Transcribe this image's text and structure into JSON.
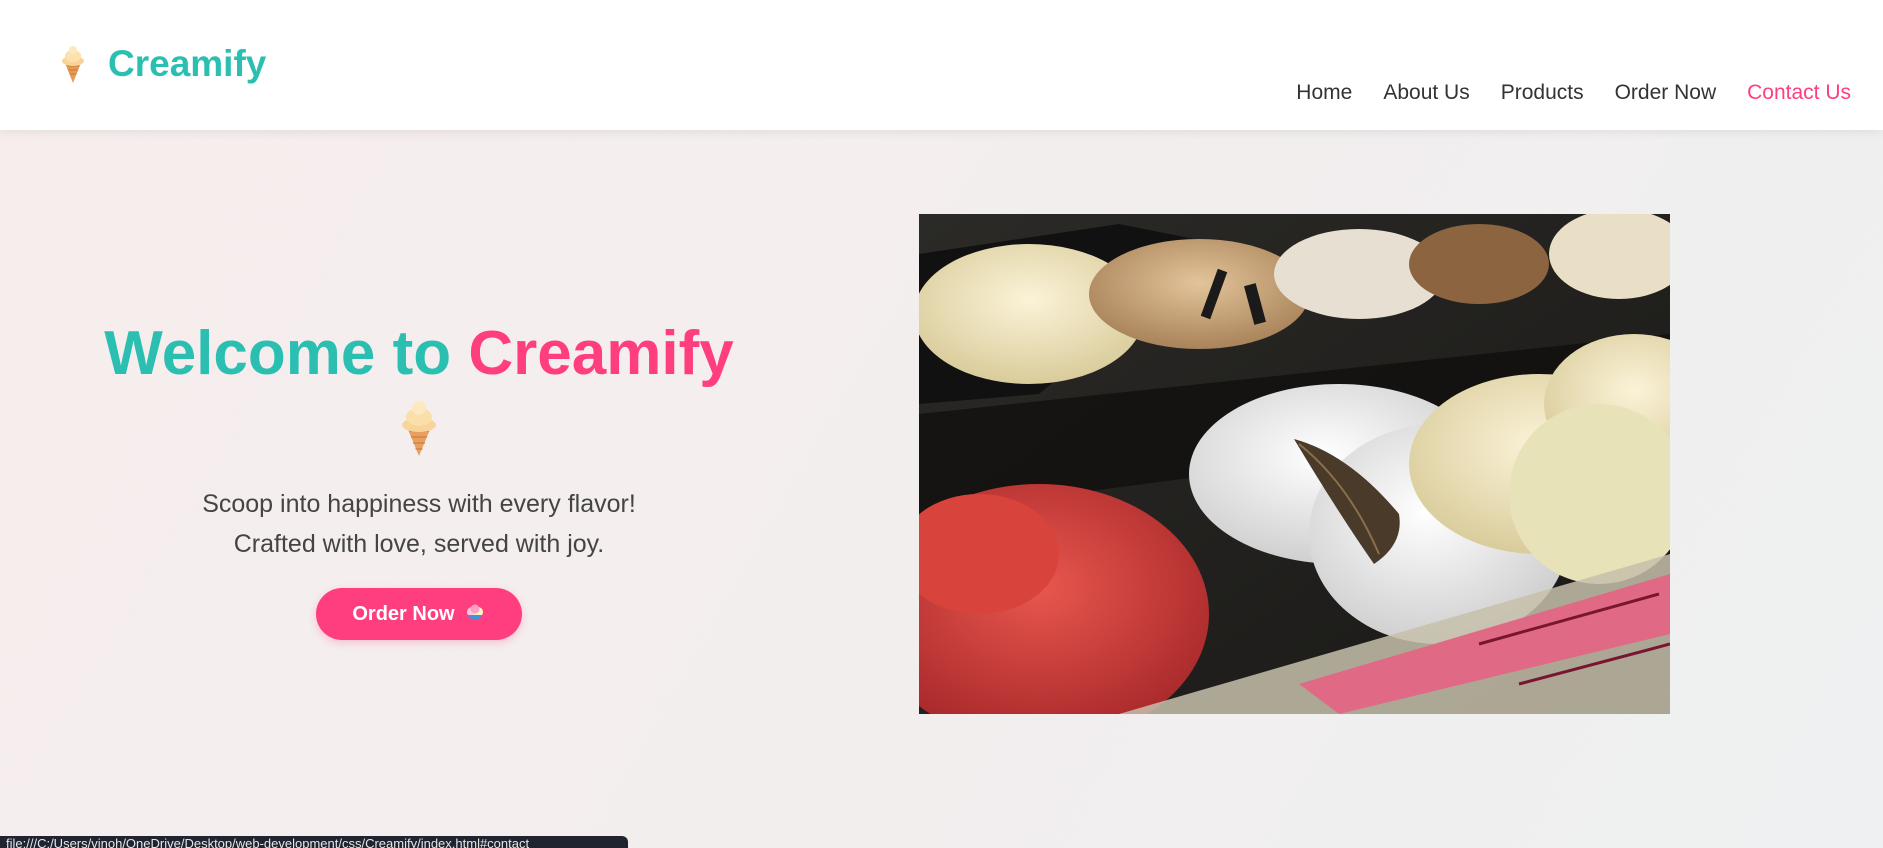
{
  "header": {
    "brand_name": "Creamify",
    "brand_icon": "ice-cream-icon"
  },
  "nav": {
    "items": [
      {
        "label": "Home"
      },
      {
        "label": "About Us"
      },
      {
        "label": "Products"
      },
      {
        "label": "Order Now"
      },
      {
        "label": "Contact Us"
      }
    ],
    "active_index": 4
  },
  "hero": {
    "title_part1": "Welcome to",
    "title_part2": "Creamify",
    "title_icon": "ice-cream-icon",
    "subtitle_line1": "Scoop into happiness with every flavor!",
    "subtitle_line2": "Crafted with love, served with joy.",
    "button_label": "Order Now",
    "button_icon": "ice-cream-bowl-icon",
    "image_icon": "gelato-display-photo"
  },
  "status_bar": {
    "url": "file:///C:/Users/vinoh/OneDrive/Desktop/web-development/css/Creamify/index.html#contact"
  },
  "colors": {
    "brand_teal": "#2bbfb2",
    "accent_pink": "#ff3e7f",
    "text_dark": "#333333"
  }
}
